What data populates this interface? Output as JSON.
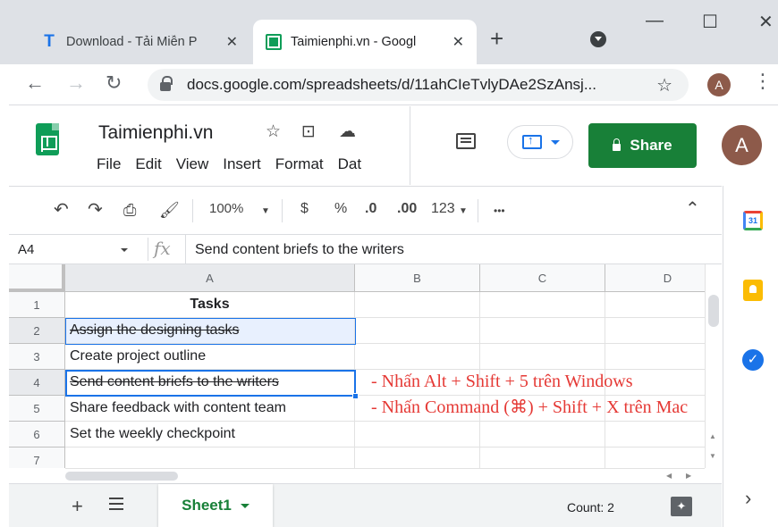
{
  "browser": {
    "tabs": [
      {
        "title": "Download - Tải Miễn P",
        "favicon": "T"
      },
      {
        "title": "Taimienphi.vn - Googl",
        "favicon": "sheets"
      }
    ],
    "new_tab": "+",
    "url": "docs.google.com/spreadsheets/d/11ahCIeTvlyDAe2SzAnsj...",
    "profile_initial": "A"
  },
  "doc": {
    "title": "Taimienphi.vn",
    "menus": [
      "File",
      "Edit",
      "View",
      "Insert",
      "Format",
      "Dat"
    ],
    "share_label": "Share",
    "avatar_initial": "A"
  },
  "toolbar": {
    "zoom": "100%",
    "currency": "$",
    "percent": "%",
    "dec_decrease": ".0",
    "dec_increase": ".00",
    "number_format": "123",
    "more": "•••"
  },
  "formula": {
    "cell_ref": "A4",
    "fx": "fx",
    "content": "Send content briefs to the writers"
  },
  "grid": {
    "columns": [
      "A",
      "B",
      "C",
      "D"
    ],
    "rows": [
      {
        "num": "1",
        "a": "Tasks"
      },
      {
        "num": "2",
        "a": "Assign the designing tasks"
      },
      {
        "num": "3",
        "a": "Create project outline"
      },
      {
        "num": "4",
        "a": "Send content briefs to the writers"
      },
      {
        "num": "5",
        "a": "Share feedback with content team"
      },
      {
        "num": "6",
        "a": "Set the weekly checkpoint"
      },
      {
        "num": "7",
        "a": ""
      }
    ]
  },
  "annotations": [
    "- Nhấn Alt + Shift + 5 trên Windows",
    "- Nhấn Command (⌘) + Shift + X trên Mac"
  ],
  "sheetbar": {
    "sheet_name": "Sheet1",
    "count": "Count: 2"
  },
  "colors": {
    "accent": "#1a73e8",
    "share_green": "#188038",
    "annotation_red": "#e53935"
  }
}
